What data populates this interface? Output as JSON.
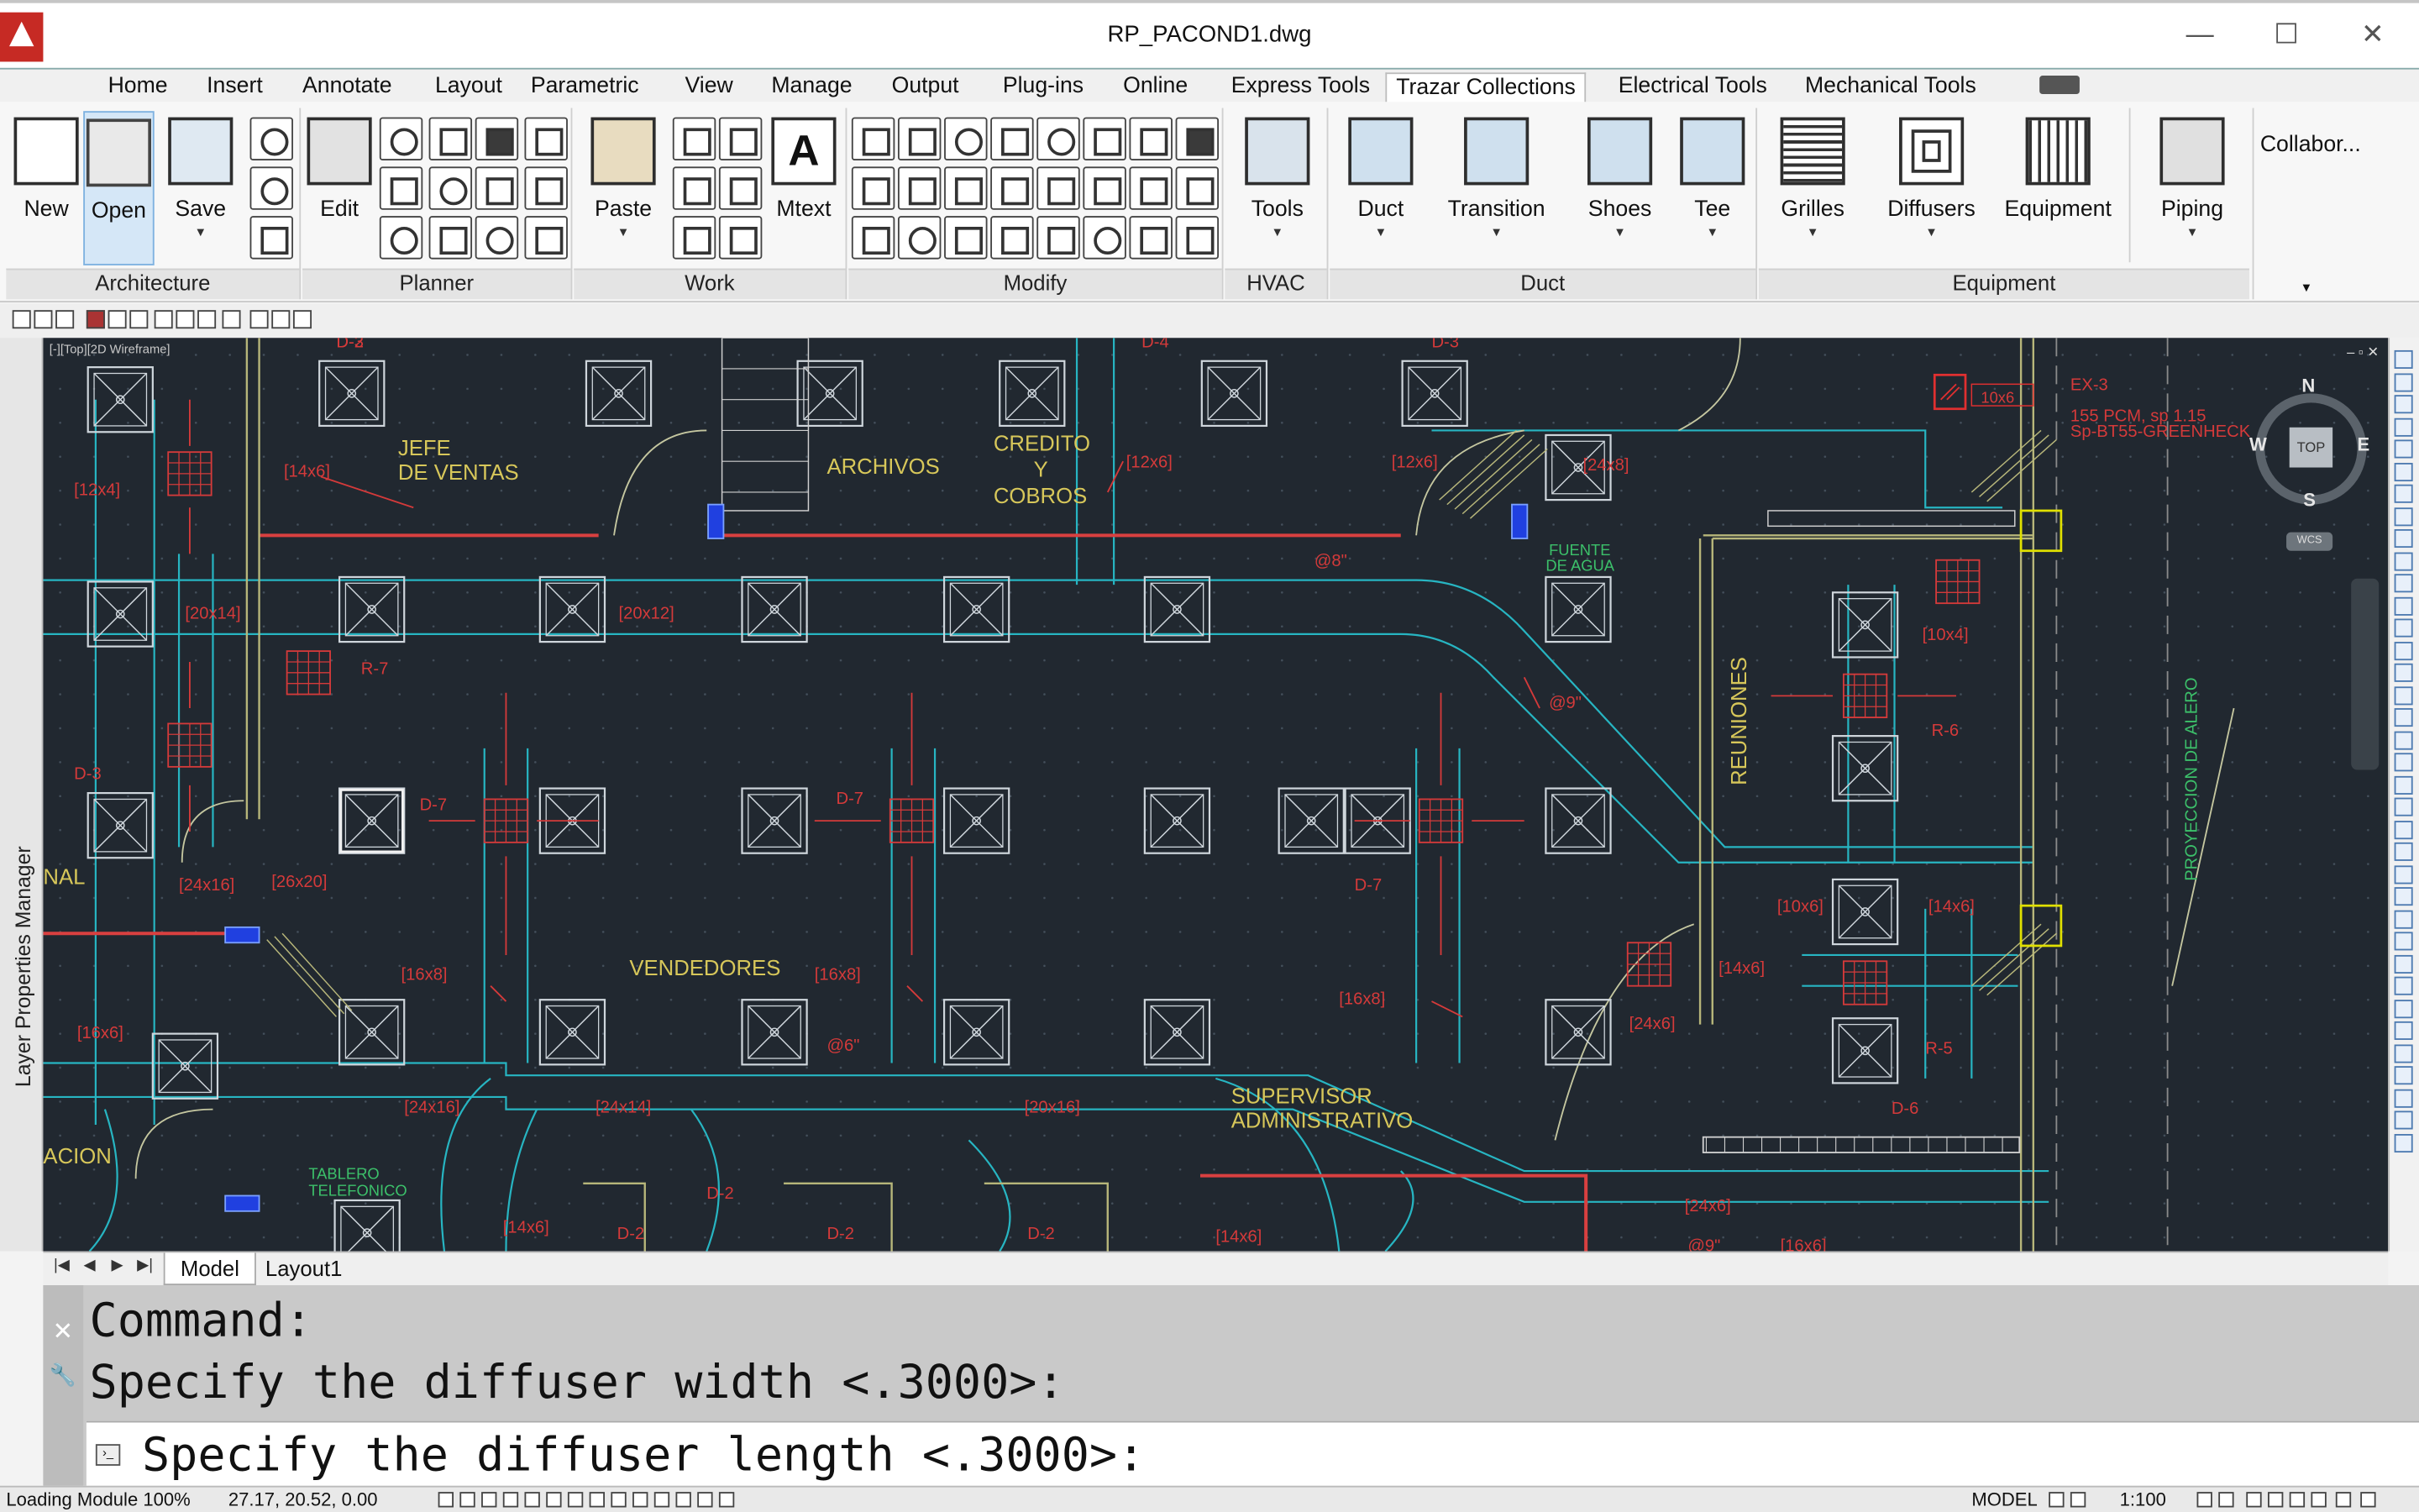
{
  "window": {
    "title": "RP_PACOND1.dwg",
    "minimize_glyph": "—",
    "maximize_glyph": "☐",
    "close_glyph": "✕"
  },
  "ribbon_tabs": [
    {
      "label": "Home",
      "active": false
    },
    {
      "label": "Insert",
      "active": false
    },
    {
      "label": "Annotate",
      "active": false
    },
    {
      "label": "Layout",
      "active": false
    },
    {
      "label": "Parametric",
      "active": false
    },
    {
      "label": "View",
      "active": false
    },
    {
      "label": "Manage",
      "active": false
    },
    {
      "label": "Output",
      "active": false
    },
    {
      "label": "Plug-ins",
      "active": false
    },
    {
      "label": "Online",
      "active": false
    },
    {
      "label": "Express Tools",
      "active": false
    },
    {
      "label": "Trazar Collections",
      "active": true
    },
    {
      "label": "Electrical Tools",
      "active": false
    },
    {
      "label": "Mechanical Tools",
      "active": false
    }
  ],
  "ribbon": {
    "buttons": {
      "new": "New",
      "open": "Open",
      "save": "Save",
      "edit": "Edit",
      "paste": "Paste",
      "mtext": "Mtext",
      "tools": "Tools",
      "duct": "Duct",
      "transition": "Transition",
      "shoes": "Shoes",
      "tee": "Tee",
      "grilles": "Grilles",
      "diffusers": "Diffusers",
      "equipment": "Equipment",
      "piping": "Piping",
      "collaborate": "Collabor..."
    },
    "panels": {
      "architecture": "Architecture",
      "planner": "Planner",
      "work": "Work",
      "modify": "Modify",
      "hvac": "HVAC",
      "duct": "Duct",
      "equipment": "Equipment"
    }
  },
  "viewport": {
    "label": "[-][Top][2D Wireframe]",
    "controls": "– ▫ ✕",
    "viewcube": {
      "top": "TOP",
      "n": "N",
      "s": "S",
      "e": "E",
      "w": "W",
      "wcs": "WCS"
    }
  },
  "drawing_labels": {
    "jefe_ventas_1": "JEFE",
    "jefe_ventas_2": "DE VENTAS",
    "archivos": "ARCHIVOS",
    "credito_1": "CREDITO",
    "credito_2": "Y",
    "credito_3": "COBROS",
    "fuente_1": "FUENTE",
    "fuente_2": "DE AGUA",
    "vendedores": "VENDEDORES",
    "supervisor_1": "SUPERVISOR",
    "supervisor_2": "ADMINISTRATIVO",
    "tablero_1": "TABLERO",
    "tablero_2": "TELEFONICO",
    "reuniones": "REUNIONES",
    "proyeccion": "PROYECCION DE ALERO",
    "nal": "NAL",
    "acion": "ACION",
    "ex3": "EX-3",
    "ex3_spec_1": "155 PCM, sp 1.15",
    "ex3_spec_2": "Sp-BT55-GREENHECK",
    "tag_10x6": "10x6"
  },
  "drawing_red_labels": [
    "D-3",
    "D-4",
    "D-3",
    "[12x4]",
    "D-3",
    "[14x6]",
    "[12x6]",
    "[12x6]",
    "[24x8]",
    "[20x14]",
    "[20x12]",
    "R-7",
    "D-7",
    "D-7",
    "D-7",
    "[24x16]",
    "[26x20]",
    "[16x8]",
    "[16x8]",
    "[16x8]",
    "[24x16]",
    "[24x14]",
    "[20x16]",
    "D-2",
    "D-2",
    "D-2",
    "D-2",
    "[14x6]",
    "[14x6]",
    "[10x4]",
    "R-6",
    "[14x6]",
    "[14x6]",
    "[24x6]",
    "R-5",
    "D-6",
    "[24x6]",
    "[16x6]",
    "[10x6]",
    "@8\"",
    "@6\"",
    "@9\"",
    "@9\"",
    "[16x6]",
    "D-2"
  ],
  "layout_tabs": [
    {
      "label": "Model",
      "active": true
    },
    {
      "label": "Layout1",
      "active": false
    }
  ],
  "palettes": {
    "layer_manager": "Layer Properties Manager"
  },
  "command": {
    "history": [
      "Command:",
      "Specify the diffuser width <.3000>:"
    ],
    "current": "Specify the diffuser length <.3000>:",
    "close_glyph": "✕",
    "wrench_glyph": "🔧"
  },
  "status": {
    "loading": "Loading Module 100%",
    "coords": "27.17, 20.52, 0.00",
    "space": "MODEL",
    "scale": "1:100"
  }
}
